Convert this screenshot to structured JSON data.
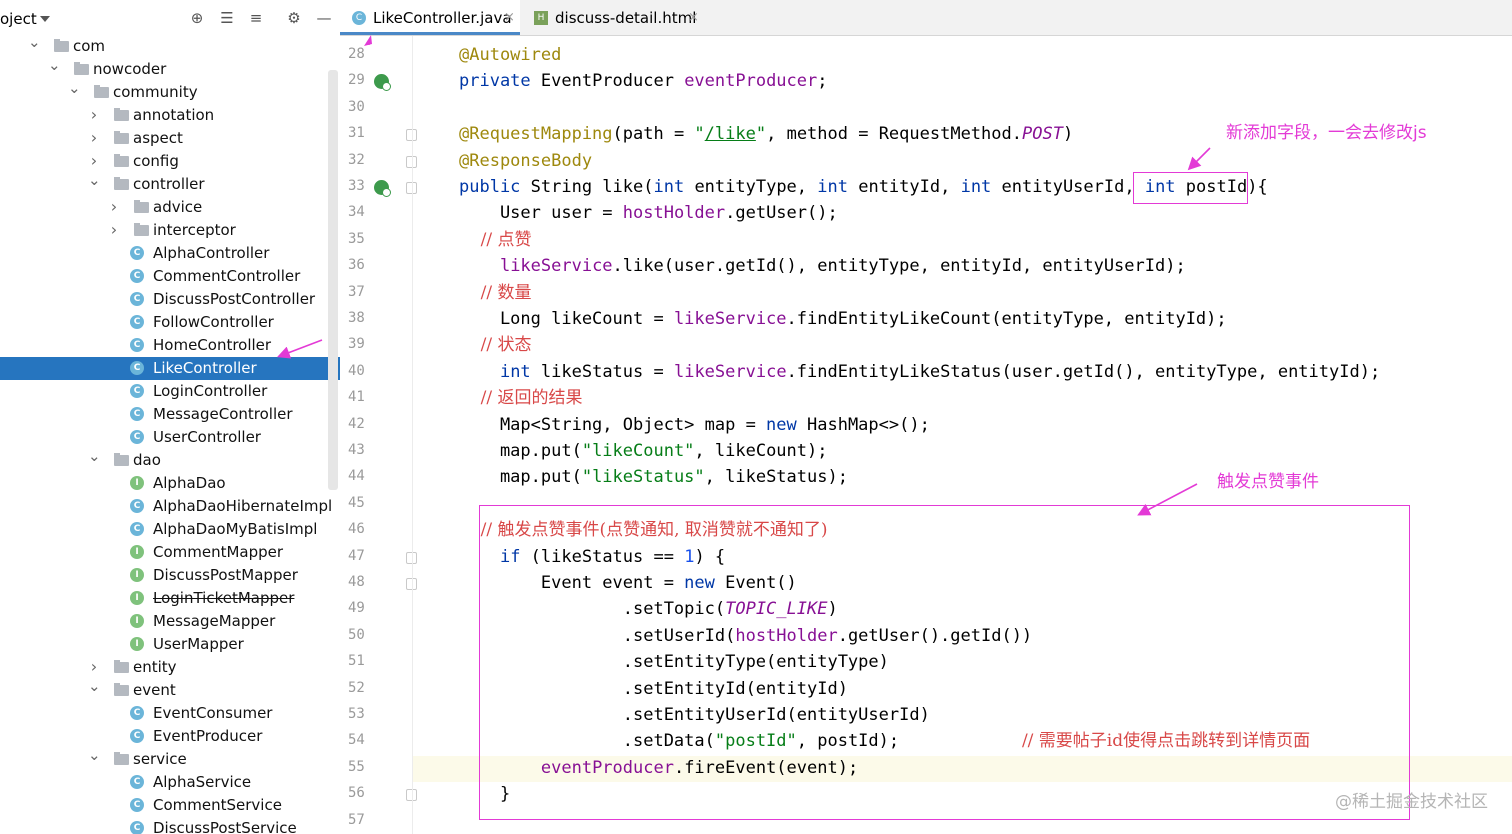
{
  "project": {
    "title": "oject",
    "toolbar_icons": [
      "locate-icon",
      "expand-all-icon",
      "collapse-all-icon",
      "gear-icon",
      "minimize-icon"
    ]
  },
  "tree": [
    {
      "label": "com",
      "kind": "folder",
      "expanded": true,
      "level": 0
    },
    {
      "label": "nowcoder",
      "kind": "folder",
      "expanded": true,
      "level": 1
    },
    {
      "label": "community",
      "kind": "folder",
      "expanded": true,
      "level": 2
    },
    {
      "label": "annotation",
      "kind": "folder",
      "expanded": false,
      "level": 3
    },
    {
      "label": "aspect",
      "kind": "folder",
      "expanded": false,
      "level": 3
    },
    {
      "label": "config",
      "kind": "folder",
      "expanded": false,
      "level": 3
    },
    {
      "label": "controller",
      "kind": "folder",
      "expanded": true,
      "level": 3
    },
    {
      "label": "advice",
      "kind": "folder",
      "expanded": false,
      "level": 4
    },
    {
      "label": "interceptor",
      "kind": "folder",
      "expanded": false,
      "level": 4
    },
    {
      "label": "AlphaController",
      "kind": "class",
      "level": 4
    },
    {
      "label": "CommentController",
      "kind": "class",
      "level": 4
    },
    {
      "label": "DiscussPostController",
      "kind": "class",
      "level": 4
    },
    {
      "label": "FollowController",
      "kind": "class",
      "level": 4
    },
    {
      "label": "HomeController",
      "kind": "class",
      "level": 4
    },
    {
      "label": "LikeController",
      "kind": "class",
      "level": 4,
      "selected": true
    },
    {
      "label": "LoginController",
      "kind": "class",
      "level": 4
    },
    {
      "label": "MessageController",
      "kind": "class",
      "level": 4
    },
    {
      "label": "UserController",
      "kind": "class",
      "level": 4
    },
    {
      "label": "dao",
      "kind": "folder",
      "expanded": true,
      "level": 3
    },
    {
      "label": "AlphaDao",
      "kind": "interface",
      "level": 4
    },
    {
      "label": "AlphaDaoHibernateImpl",
      "kind": "class",
      "level": 4
    },
    {
      "label": "AlphaDaoMyBatisImpl",
      "kind": "class",
      "level": 4
    },
    {
      "label": "CommentMapper",
      "kind": "interface",
      "level": 4
    },
    {
      "label": "DiscussPostMapper",
      "kind": "interface",
      "level": 4
    },
    {
      "label": "LoginTicketMapper",
      "kind": "interface",
      "level": 4,
      "strike": true
    },
    {
      "label": "MessageMapper",
      "kind": "interface",
      "level": 4
    },
    {
      "label": "UserMapper",
      "kind": "interface",
      "level": 4
    },
    {
      "label": "entity",
      "kind": "folder",
      "expanded": false,
      "level": 3
    },
    {
      "label": "event",
      "kind": "folder",
      "expanded": true,
      "level": 3
    },
    {
      "label": "EventConsumer",
      "kind": "class",
      "level": 4
    },
    {
      "label": "EventProducer",
      "kind": "class",
      "level": 4
    },
    {
      "label": "service",
      "kind": "folder",
      "expanded": true,
      "level": 3
    },
    {
      "label": "AlphaService",
      "kind": "class",
      "level": 4
    },
    {
      "label": "CommentService",
      "kind": "class",
      "level": 4
    },
    {
      "label": "DiscussPostService",
      "kind": "class",
      "level": 4
    }
  ],
  "tabs": [
    {
      "label": "LikeController.java",
      "icon": "java-class-icon",
      "active": true
    },
    {
      "label": "discuss-detail.html",
      "icon": "html-file-icon",
      "active": false
    }
  ],
  "tab_close_glyph": "×",
  "gutter": {
    "line_numbers": [
      "28",
      "29",
      "30",
      "31",
      "32",
      "33",
      "34",
      "35",
      "36",
      "37",
      "38",
      "39",
      "40",
      "41",
      "42",
      "43",
      "44",
      "45",
      "46",
      "47",
      "48",
      "49",
      "50",
      "51",
      "52",
      "53",
      "54",
      "55",
      "56",
      "57"
    ],
    "bean_icon_lines": [
      "29",
      "33"
    ],
    "fold_lines": [
      "31",
      "32",
      "33",
      "47",
      "48",
      "56"
    ],
    "current_line": "55"
  },
  "code_lines": [
    [
      {
        "t": "@Autowired",
        "c": "ann"
      }
    ],
    [
      {
        "t": "private ",
        "c": "kw"
      },
      {
        "t": "EventProducer "
      },
      {
        "t": "eventProducer",
        "c": "fld"
      },
      {
        "t": ";"
      }
    ],
    [],
    [
      {
        "t": "@RequestMapping",
        "c": "ann"
      },
      {
        "t": "(path = "
      },
      {
        "t": "\"",
        "c": "str"
      },
      {
        "t": "/like",
        "c": "url"
      },
      {
        "t": "\"",
        "c": "str"
      },
      {
        "t": ", method = RequestMethod."
      },
      {
        "t": "POST",
        "c": "cst"
      },
      {
        "t": ")"
      }
    ],
    [
      {
        "t": "@ResponseBody",
        "c": "ann"
      }
    ],
    [
      {
        "t": "public ",
        "c": "kw"
      },
      {
        "t": "String like("
      },
      {
        "t": "int ",
        "c": "kw"
      },
      {
        "t": "entityType, "
      },
      {
        "t": "int ",
        "c": "kw"
      },
      {
        "t": "entityId, "
      },
      {
        "t": "int ",
        "c": "kw"
      },
      {
        "t": "entityUserId, "
      },
      {
        "t": "int ",
        "c": "kw"
      },
      {
        "t": "postId){"
      }
    ],
    [
      {
        "t": "    User user = "
      },
      {
        "t": "hostHolder",
        "c": "fld"
      },
      {
        "t": ".getUser();"
      }
    ],
    [
      {
        "t": "    // 点赞",
        "c": "cmt"
      }
    ],
    [
      {
        "t": "    "
      },
      {
        "t": "likeService",
        "c": "fld"
      },
      {
        "t": ".like(user.getId(), entityType, entityId, entityUserId);"
      }
    ],
    [
      {
        "t": "    // 数量",
        "c": "cmt"
      }
    ],
    [
      {
        "t": "    Long likeCount = "
      },
      {
        "t": "likeService",
        "c": "fld"
      },
      {
        "t": ".findEntityLikeCount(entityType, entityId);"
      }
    ],
    [
      {
        "t": "    // 状态",
        "c": "cmt"
      }
    ],
    [
      {
        "t": "    "
      },
      {
        "t": "int ",
        "c": "kw"
      },
      {
        "t": "likeStatus = "
      },
      {
        "t": "likeService",
        "c": "fld"
      },
      {
        "t": ".findEntityLikeStatus(user.getId(), entityType, entityId);"
      }
    ],
    [
      {
        "t": "    // 返回的结果",
        "c": "cmt"
      }
    ],
    [
      {
        "t": "    Map<String, Object> map = "
      },
      {
        "t": "new ",
        "c": "kw"
      },
      {
        "t": "HashMap<>();"
      }
    ],
    [
      {
        "t": "    map.put("
      },
      {
        "t": "\"likeCount\"",
        "c": "str"
      },
      {
        "t": ", likeCount);"
      }
    ],
    [
      {
        "t": "    map.put("
      },
      {
        "t": "\"likeStatus\"",
        "c": "str"
      },
      {
        "t": ", likeStatus);"
      }
    ],
    [],
    [
      {
        "t": "    // 触发点赞事件(点赞通知, 取消赞就不通知了)",
        "c": "cmt"
      }
    ],
    [
      {
        "t": "    "
      },
      {
        "t": "if ",
        "c": "kw"
      },
      {
        "t": "(likeStatus == "
      },
      {
        "t": "1",
        "c": "num"
      },
      {
        "t": ") {"
      }
    ],
    [
      {
        "t": "        Event event = "
      },
      {
        "t": "new ",
        "c": "kw"
      },
      {
        "t": "Event()"
      }
    ],
    [
      {
        "t": "                .setTopic("
      },
      {
        "t": "TOPIC_LIKE",
        "c": "cst"
      },
      {
        "t": ")"
      }
    ],
    [
      {
        "t": "                .setUserId("
      },
      {
        "t": "hostHolder",
        "c": "fld"
      },
      {
        "t": ".getUser().getId())"
      }
    ],
    [
      {
        "t": "                .setEntityType(entityType)"
      }
    ],
    [
      {
        "t": "                .setEntityId(entityId)"
      }
    ],
    [
      {
        "t": "                .setEntityUserId(entityUserId)"
      }
    ],
    [
      {
        "t": "                .setData("
      },
      {
        "t": "\"postId\"",
        "c": "str"
      },
      {
        "t": ", postId);            "
      },
      {
        "t": "// 需要帖子id使得点击跳转到详情页面",
        "c": "cmt"
      }
    ],
    [
      {
        "t": "        "
      },
      {
        "t": "eventProducer",
        "c": "fld"
      },
      {
        "t": ".fireEvent(event);"
      }
    ],
    [
      {
        "t": "    }"
      }
    ],
    []
  ],
  "annotations": {
    "note_field": "新添加字段，一会去修改js",
    "note_event": "触发点赞事件",
    "color": "#e33ad6"
  },
  "watermark": "@稀土掘金技术社区"
}
